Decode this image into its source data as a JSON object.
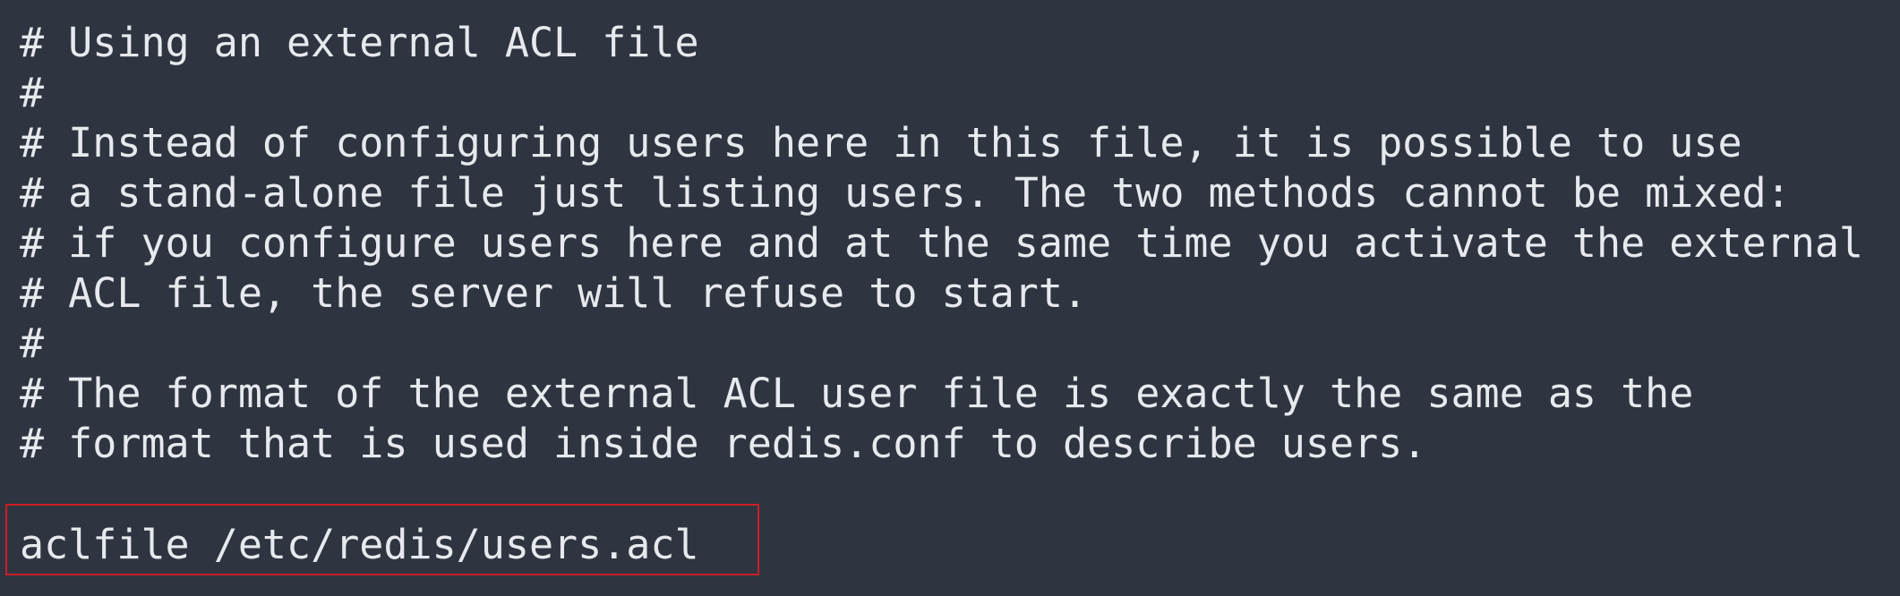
{
  "comment_lines": [
    "# Using an external ACL file",
    "#",
    "# Instead of configuring users here in this file, it is possible to use",
    "# a stand-alone file just listing users. The two methods cannot be mixed:",
    "# if you configure users here and at the same time you activate the external",
    "# ACL file, the server will refuse to start.",
    "#",
    "# The format of the external ACL user file is exactly the same as the",
    "# format that is used inside redis.conf to describe users."
  ],
  "directive_line": "aclfile /etc/redis/users.acl",
  "colors": {
    "background": "#2e3540",
    "text": "#e6e9ee",
    "highlight_border": "#c91f26"
  }
}
